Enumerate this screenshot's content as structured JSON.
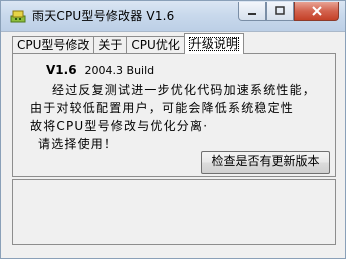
{
  "window": {
    "title": "雨天CPU型号修改器  V1.6",
    "icon": "app-icon",
    "buttons": {
      "minimize": "0",
      "maximize": "1",
      "close": "r"
    }
  },
  "tabs": [
    {
      "label": "CPU型号修改",
      "active": false
    },
    {
      "label": "关于",
      "active": false
    },
    {
      "label": "CPU优化",
      "active": false
    },
    {
      "label": "升级说明",
      "active": true
    }
  ],
  "upgrade": {
    "version": "V1.6",
    "build": "2004.3 Build",
    "lines": [
      "经过反复测试进一步优化代码加速系统性能，",
      "由于对较低配置用户，可能会降低系统稳定性",
      "故将CPU型号修改与优化分离·",
      "请选择使用！"
    ],
    "check_button": "检查是否有更新版本"
  },
  "colors": {
    "titlebar": "#c9d9ec",
    "close": "#c44128",
    "face": "#f0f0f0"
  }
}
